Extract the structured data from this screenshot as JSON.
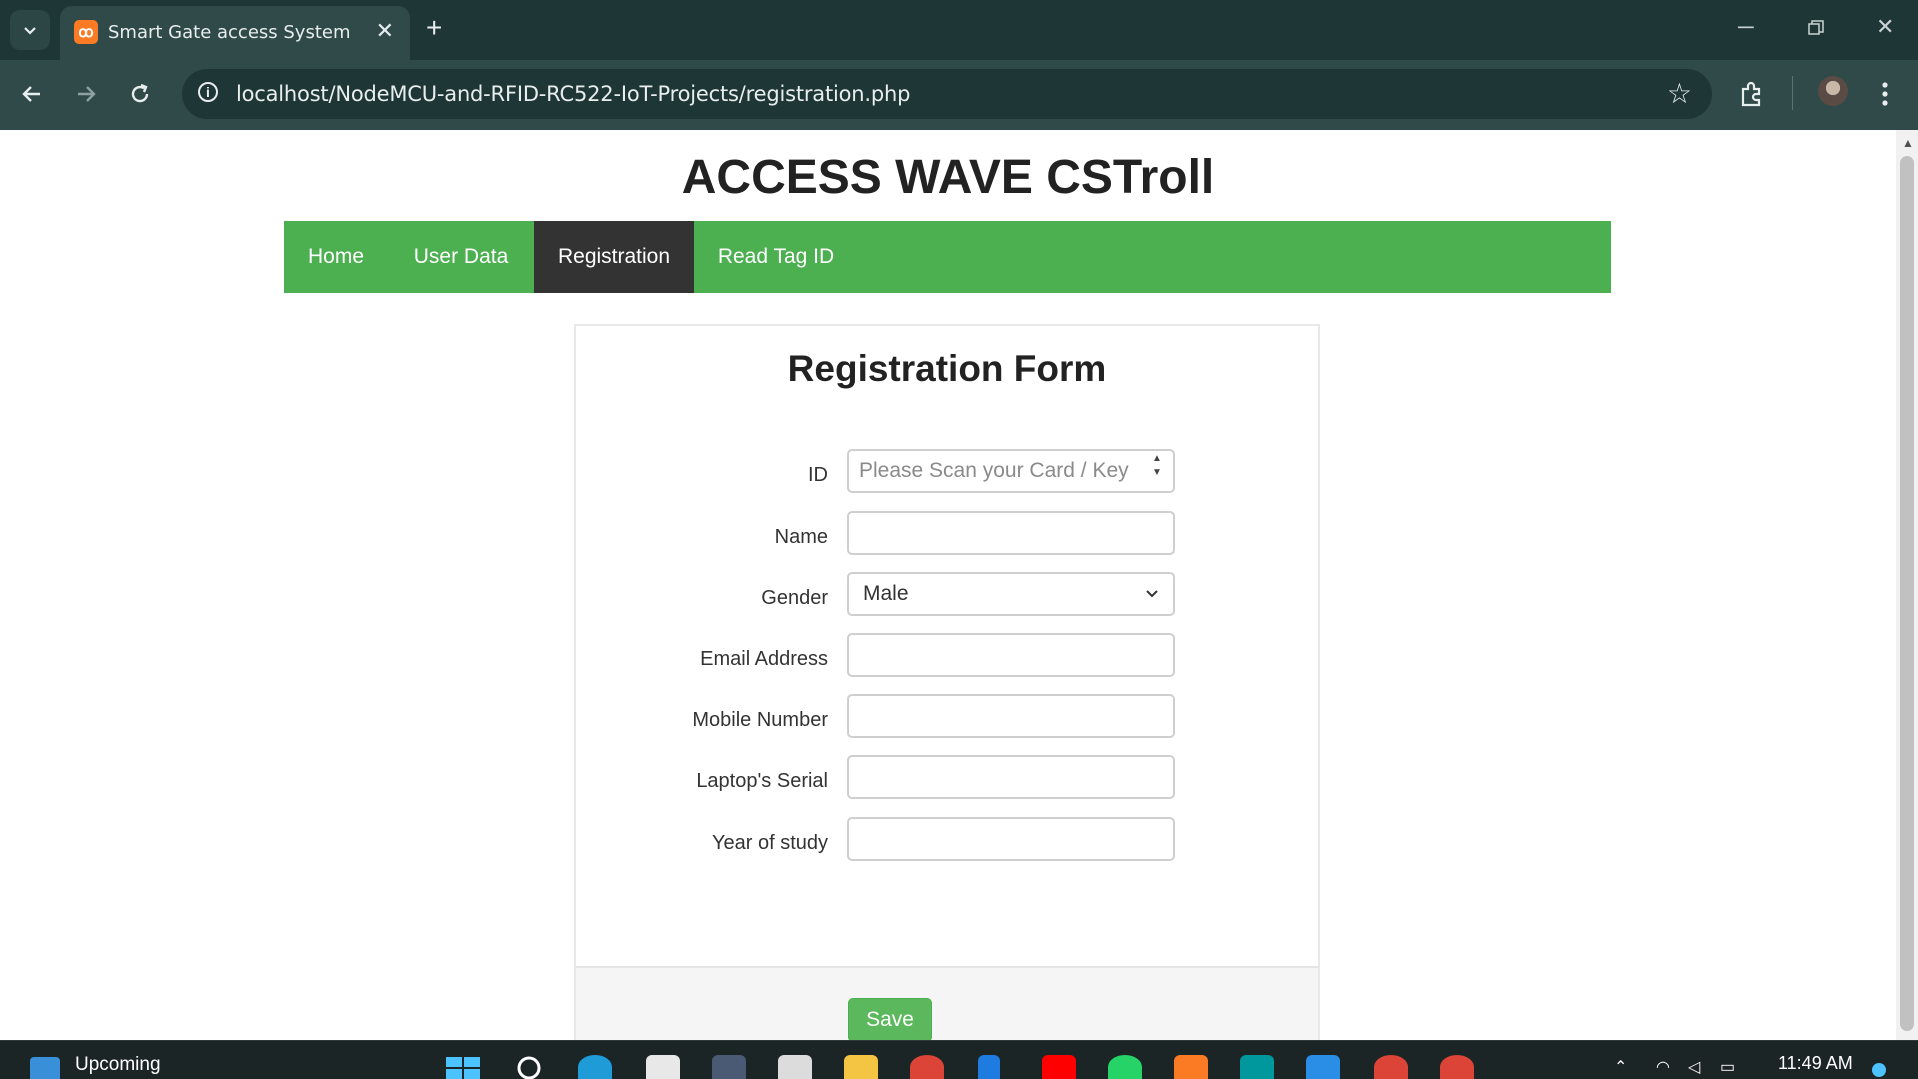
{
  "browser": {
    "tab_title": "Smart Gate access System",
    "favicon_glyph": "ꝏ",
    "url": "localhost/NodeMCU-and-RFID-RC522-IoT-Projects/registration.php",
    "icons": {
      "tab_list": "chevron-down-icon",
      "close_tab": "close-icon",
      "new_tab": "plus-icon",
      "back": "arrow-left-icon",
      "forward": "arrow-right-icon",
      "reload": "reload-icon",
      "site_info": "info-icon",
      "bookmark": "star-icon",
      "extensions": "puzzle-icon",
      "menu": "kebab-menu-icon",
      "minimize": "minimize-icon",
      "restore": "restore-icon",
      "close_window": "close-icon"
    }
  },
  "page": {
    "site_title": "ACCESS WAVE CSTroll",
    "nav": [
      {
        "label": "Home",
        "active": false
      },
      {
        "label": "User Data",
        "active": false
      },
      {
        "label": "Registration",
        "active": true
      },
      {
        "label": "Read Tag ID",
        "active": false
      }
    ],
    "form": {
      "heading": "Registration Form",
      "fields": {
        "id": {
          "label": "ID",
          "placeholder": "Please Scan your Card / Key",
          "value": ""
        },
        "name": {
          "label": "Name",
          "value": ""
        },
        "gender": {
          "label": "Gender",
          "selected": "Male"
        },
        "email": {
          "label": "Email Address",
          "value": ""
        },
        "mobile": {
          "label": "Mobile Number",
          "value": ""
        },
        "laptop_serial": {
          "label": "Laptop's Serial",
          "value": ""
        },
        "year_of_study": {
          "label": "Year of study",
          "value": ""
        }
      },
      "save_label": "Save"
    }
  },
  "taskbar": {
    "weather_label": "Upcoming",
    "time": "11:49 AM"
  },
  "colors": {
    "nav_green": "#4caf50",
    "nav_active": "#333333",
    "save_green": "#5cb85c",
    "chrome_dark": "#1f3636",
    "chrome_toolbar": "#2f4a49"
  }
}
